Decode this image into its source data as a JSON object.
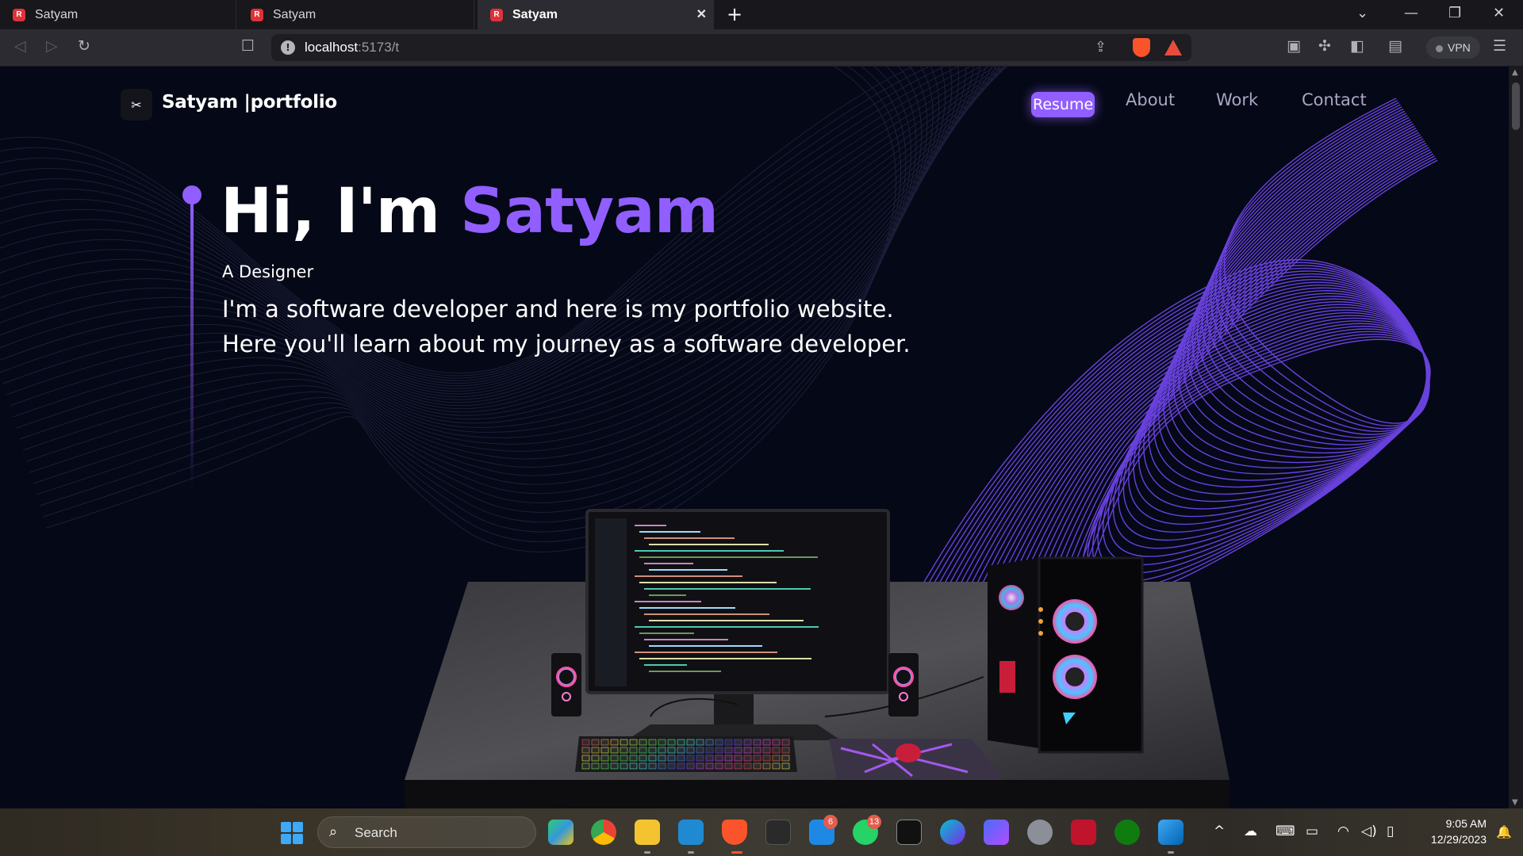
{
  "browser": {
    "tabs": [
      {
        "title": "Satyam",
        "active": false
      },
      {
        "title": "Satyam",
        "active": false
      },
      {
        "title": "Satyam",
        "active": true
      }
    ],
    "url_host": "localhost",
    "url_path": ":5173/t",
    "vpn_label": "VPN"
  },
  "nav": {
    "logo_text": "Satyam |portfolio",
    "links": [
      "Resume",
      "About",
      "Work",
      "Contact"
    ]
  },
  "hero": {
    "greeting": "Hi, I'm ",
    "name": "Satyam",
    "role": "A Designer",
    "line1": "I'm a software developer and here is my portfolio website.",
    "line2": "Here you'll learn about my journey as a software developer."
  },
  "taskbar": {
    "search_label": "Search",
    "badges": {
      "mail": "6",
      "whatsapp": "13"
    },
    "time": "9:05 AM",
    "date": "12/29/2023"
  },
  "colors": {
    "accent": "#915eff",
    "background": "#050816",
    "nav_text": "#aaa6c3"
  },
  "icons": [
    "back-icon",
    "forward-icon",
    "reload-icon",
    "bookmark-icon",
    "info-icon",
    "share-icon",
    "brave-shield-icon",
    "brave-rewards-icon",
    "sidebar-icon",
    "extensions-icon",
    "wallet-icon",
    "menu-icon",
    "windows-start-icon",
    "search-icon",
    "wifi-icon",
    "volume-icon",
    "battery-icon",
    "bell-icon"
  ]
}
